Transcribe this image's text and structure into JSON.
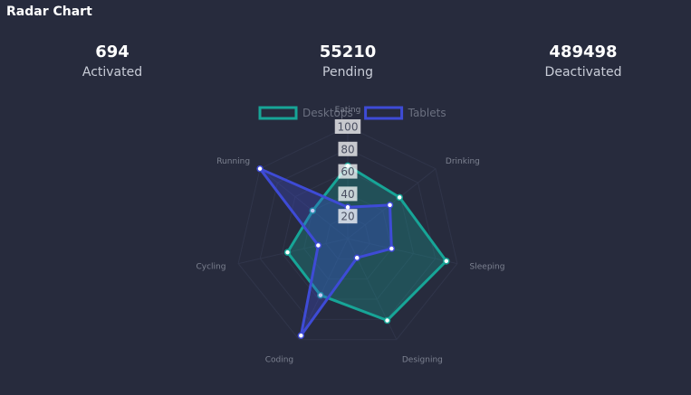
{
  "title": "Radar Chart",
  "stats": [
    {
      "value": "694",
      "label": "Activated"
    },
    {
      "value": "55210",
      "label": "Pending"
    },
    {
      "value": "489498",
      "label": "Deactivated"
    }
  ],
  "chart_data": {
    "type": "radar",
    "categories": [
      "Eating",
      "Drinking",
      "Sleeping",
      "Designing",
      "Coding",
      "Cycling",
      "Running"
    ],
    "series": [
      {
        "name": "Desktops",
        "color": "#17a597",
        "values": [
          65,
          59,
          90,
          81,
          56,
          55,
          40
        ]
      },
      {
        "name": "Tablets",
        "color": "#3e4bd6",
        "values": [
          28,
          48,
          40,
          19,
          96,
          27,
          100
        ]
      }
    ],
    "ticks": [
      "20",
      "40",
      "60",
      "80",
      "100"
    ],
    "range": [
      0,
      100
    ],
    "legend": "top"
  }
}
